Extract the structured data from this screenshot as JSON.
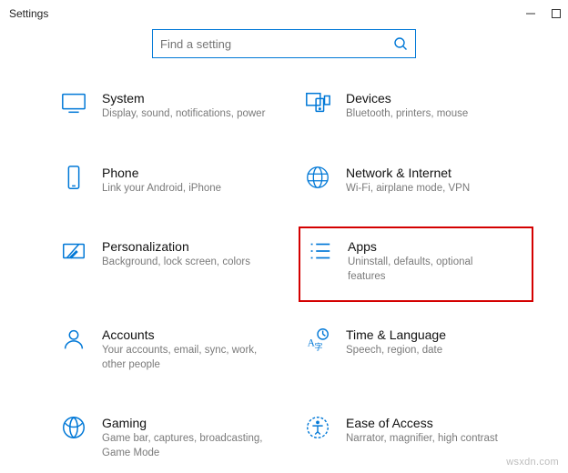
{
  "window": {
    "title": "Settings"
  },
  "search": {
    "placeholder": "Find a setting"
  },
  "tiles": {
    "system": {
      "title": "System",
      "sub": "Display, sound, notifications, power"
    },
    "devices": {
      "title": "Devices",
      "sub": "Bluetooth, printers, mouse"
    },
    "phone": {
      "title": "Phone",
      "sub": "Link your Android, iPhone"
    },
    "network": {
      "title": "Network & Internet",
      "sub": "Wi-Fi, airplane mode, VPN"
    },
    "personalization": {
      "title": "Personalization",
      "sub": "Background, lock screen, colors"
    },
    "apps": {
      "title": "Apps",
      "sub": "Uninstall, defaults, optional features"
    },
    "accounts": {
      "title": "Accounts",
      "sub": "Your accounts, email, sync, work, other people"
    },
    "time": {
      "title": "Time & Language",
      "sub": "Speech, region, date"
    },
    "gaming": {
      "title": "Gaming",
      "sub": "Game bar, captures, broadcasting, Game Mode"
    },
    "ease": {
      "title": "Ease of Access",
      "sub": "Narrator, magnifier, high contrast"
    }
  },
  "watermark": "wsxdn.com"
}
